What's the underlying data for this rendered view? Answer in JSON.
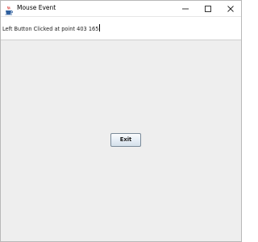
{
  "window": {
    "title": "Mouse Event",
    "icon": "java-cup-icon"
  },
  "controls": {
    "minimize_icon": "minimize-icon",
    "maximize_icon": "maximize-icon",
    "close_icon": "close-icon"
  },
  "text_field": {
    "value": "Left Button Clicked at point 403 165"
  },
  "buttons": {
    "exit_label": "Exit"
  },
  "colors": {
    "background": "#eeeeee",
    "titlebar": "#ffffff",
    "button_border": "#7a8a99"
  }
}
